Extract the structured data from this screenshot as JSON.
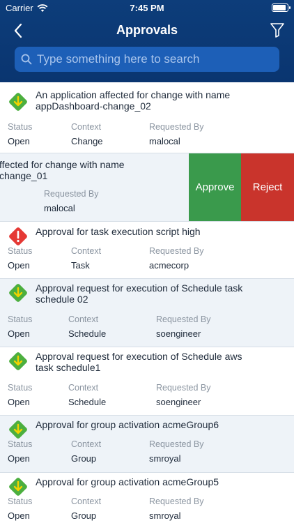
{
  "status_bar": {
    "carrier": "Carrier",
    "time": "7:45 PM"
  },
  "nav": {
    "title": "Approvals",
    "back_icon": "chevron-left-icon",
    "filter_icon": "funnel-icon"
  },
  "search": {
    "placeholder": "Type something here to search",
    "value": ""
  },
  "field_labels": {
    "status": "Status",
    "context": "Context",
    "requested_by": "Requested By"
  },
  "actions": {
    "approve": "Approve",
    "reject": "Reject"
  },
  "colors": {
    "header": "#0a3570",
    "search_bg": "#1d5fb7",
    "approve": "#3a9a4c",
    "reject": "#c9342c",
    "icon_ok": "#4caf3f",
    "icon_alert": "#e53935"
  },
  "approvals": [
    {
      "icon": "green-diamond-arrow-icon",
      "line1": "An application affected for change with name",
      "line2": "appDashboard-change_02",
      "status": "Open",
      "context": "Change",
      "requested_by": "malocal"
    },
    {
      "icon": "none",
      "line1": "ffected for change with name",
      "line2": "change_01",
      "status": "",
      "context": "",
      "requested_by": "malocal",
      "swiped": true
    },
    {
      "icon": "red-diamond-alert-icon",
      "line1": "Approval for task execution  script high",
      "line2": "",
      "status": "Open",
      "context": "Task",
      "requested_by": "acmecorp"
    },
    {
      "icon": "green-diamond-arrow-icon",
      "line1": "Approval request for execution of Schedule task",
      "line2": "schedule 02",
      "status": "Open",
      "context": "Schedule",
      "requested_by": "soengineer"
    },
    {
      "icon": "green-diamond-arrow-icon",
      "line1": "Approval request for execution of Schedule aws",
      "line2": "task schedule1",
      "status": "Open",
      "context": "Schedule",
      "requested_by": "soengineer"
    },
    {
      "icon": "green-diamond-arrow-icon",
      "line1": "Approval for group activation acmeGroup6",
      "line2": "",
      "status": "Open",
      "context": "Group",
      "requested_by": "smroyal"
    },
    {
      "icon": "green-diamond-arrow-icon",
      "line1": "Approval for group activation acmeGroup5",
      "line2": "",
      "status": "Open",
      "context": "Group",
      "requested_by": "smroyal"
    }
  ]
}
